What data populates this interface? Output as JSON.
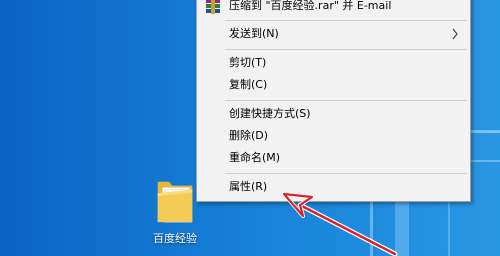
{
  "desktop": {
    "folder": {
      "label": "百度经验",
      "icon": "folder-icon"
    }
  },
  "context_menu": {
    "items": [
      {
        "label": "压缩到 \"百度经验.rar\" 并 E-mail",
        "icon": "winrar-icon"
      },
      {
        "label": "发送到(N)",
        "submenu": true
      },
      {
        "label": "剪切(T)"
      },
      {
        "label": "复制(C)"
      },
      {
        "label": "创建快捷方式(S)"
      },
      {
        "label": "删除(D)"
      },
      {
        "label": "重命名(M)"
      },
      {
        "label": "属性(R)"
      }
    ]
  },
  "colors": {
    "annotation_arrow": "#d9222a",
    "menu_bg": "#f2f2f2",
    "desktop_bg": "#1a7fd6"
  }
}
